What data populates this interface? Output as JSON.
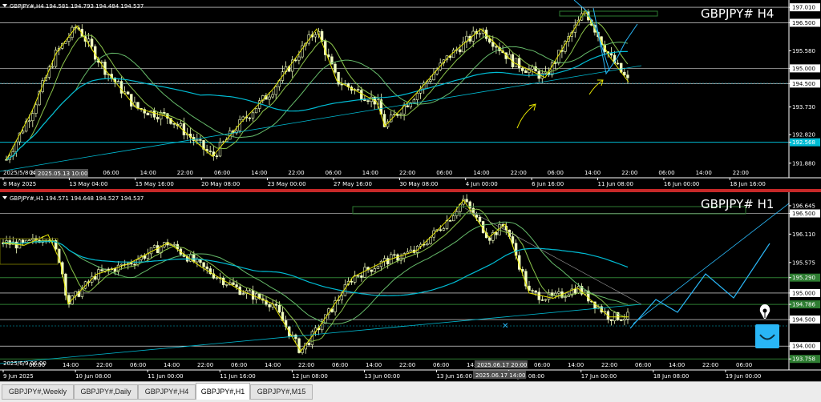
{
  "charts": {
    "h4": {
      "big_title": "GBPJPY# H4",
      "info_line": "GBPJPY#,H4  194.581 194.793 194.484 194.537",
      "price_labels": [
        {
          "text": "197.010",
          "value": 197.01,
          "highlight": true
        },
        {
          "text": "196.500",
          "value": 196.5,
          "highlight": true
        },
        {
          "text": "195.580",
          "value": 195.58
        },
        {
          "text": "195.000",
          "value": 195.0,
          "highlight": true
        },
        {
          "text": "194.500",
          "value": 194.5,
          "highlight": true
        },
        {
          "text": "193.730",
          "value": 193.73
        },
        {
          "text": "192.820",
          "value": 192.82
        },
        {
          "text": "192.568",
          "value": 192.568,
          "color": "#00bcd4"
        },
        {
          "text": "191.880",
          "value": 191.88
        }
      ],
      "time_labels": [
        "8 May 2025",
        "13 May 04:00",
        "15 May 16:00",
        "20 May 08:00",
        "23 May 00:00",
        "27 May 16:00",
        "30 May 08:00",
        "4 Jun 00:00",
        "6 Jun 16:00",
        "11 Jun 08:00",
        "16 Jun 00:00",
        "18 Jun 16:00"
      ],
      "grid_time_labels": [
        "04:00",
        "22:00",
        "06:00",
        "14:00",
        "22:00",
        "06:00",
        "14:00",
        "22:00",
        "06:00",
        "14:00",
        "22:00",
        "06:00",
        "14:00",
        "22:00",
        "06:00",
        "14:00",
        "22:00",
        "06:00",
        "14:00",
        "22:00"
      ],
      "date_marker_left": "2025/5/8 22",
      "date_marker_box": "2025.05.13 10:00"
    },
    "h1": {
      "big_title": "GBPJPY# H1",
      "info_line": "GBPJPY#,H1  194.571 194.648 194.527 194.537",
      "price_labels": [
        {
          "text": "196.645",
          "value": 196.645
        },
        {
          "text": "196.500",
          "value": 196.5,
          "highlight": true
        },
        {
          "text": "196.110",
          "value": 196.11
        },
        {
          "text": "195.575",
          "value": 195.575
        },
        {
          "text": "195.290",
          "value": 195.29,
          "color": "#2e7d32"
        },
        {
          "text": "195.000",
          "value": 195.0,
          "highlight": true
        },
        {
          "text": "194.786",
          "value": 194.786,
          "color": "#2e7d32"
        },
        {
          "text": "194.500",
          "value": 194.5,
          "highlight": true
        },
        {
          "text": "194.000",
          "value": 194.0,
          "highlight": true
        },
        {
          "text": "193.758",
          "value": 193.758,
          "color": "#2e7d32"
        }
      ],
      "time_labels": [
        "9 Jun 2025",
        "10 Jun 08:00",
        "11 Jun 00:00",
        "11 Jun 16:00",
        "12 Jun 08:00",
        "13 Jun 00:00",
        "13 Jun 16:00",
        "16 Jun 08:00",
        "17 Jun 00:00",
        "18 Jun 08:00",
        "19 Jun 00:00"
      ],
      "grid_time_labels": [
        "06:00",
        "14:00",
        "22:00",
        "06:00",
        "14:00",
        "22:00",
        "06:00",
        "14:00",
        "22:00",
        "06:00",
        "14:00",
        "22:00",
        "06:00",
        "14:00",
        "22:00",
        "06:00",
        "14:00",
        "22:00",
        "06:00",
        "14:00",
        "22:00",
        "06:00"
      ],
      "date_marker_left": "2025/6/9 06:00",
      "date_marker_box_top": "2025.06.17 20:00",
      "date_marker_box_bottom": "2025.06.17 14:00"
    }
  },
  "tabs": [
    {
      "label": "GBPJPY#,Weekly",
      "active": false
    },
    {
      "label": "GBPJPY#,Daily",
      "active": false
    },
    {
      "label": "GBPJPY#,H4",
      "active": false
    },
    {
      "label": "GBPJPY#,H1",
      "active": true
    },
    {
      "label": "GBPJPY#,M15",
      "active": false
    }
  ],
  "colors": {
    "candle": "#f2ffc0",
    "zigzag": "#e6e600",
    "ma_fast": "#8bc34a",
    "ma_slow": "#00bcd4",
    "level_line": "#2e7d32",
    "projection": "#29b6f6"
  },
  "icons": [
    "pen-tip-icon",
    "smile-badge-icon"
  ]
}
